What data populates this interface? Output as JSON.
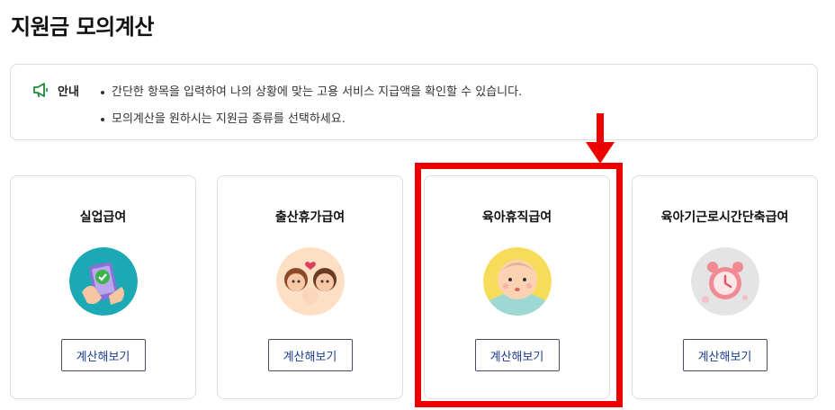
{
  "page": {
    "title": "지원금 모의계산"
  },
  "notice": {
    "icon": "megaphone-icon",
    "label": "안내",
    "lines": [
      "간단한 항목을 입력하여 나의 상황에 맞는 고용 서비스 지급액을 확인할 수 있습니다.",
      "모의계산을 원하시는 지원금 종류를 선택하세요."
    ]
  },
  "cards": [
    {
      "title": "실업급여",
      "button": "계산해보기",
      "icon": "phone-hand-check-icon"
    },
    {
      "title": "출산휴가급여",
      "button": "계산해보기",
      "icon": "family-icon"
    },
    {
      "title": "육아휴직급여",
      "button": "계산해보기",
      "icon": "baby-icon"
    },
    {
      "title": "육아기근로시간단축급여",
      "button": "계산해보기",
      "icon": "alarm-clock-icon"
    }
  ],
  "annotation": {
    "color": "#ee0000",
    "highlighted_card": "육아휴직급여"
  }
}
